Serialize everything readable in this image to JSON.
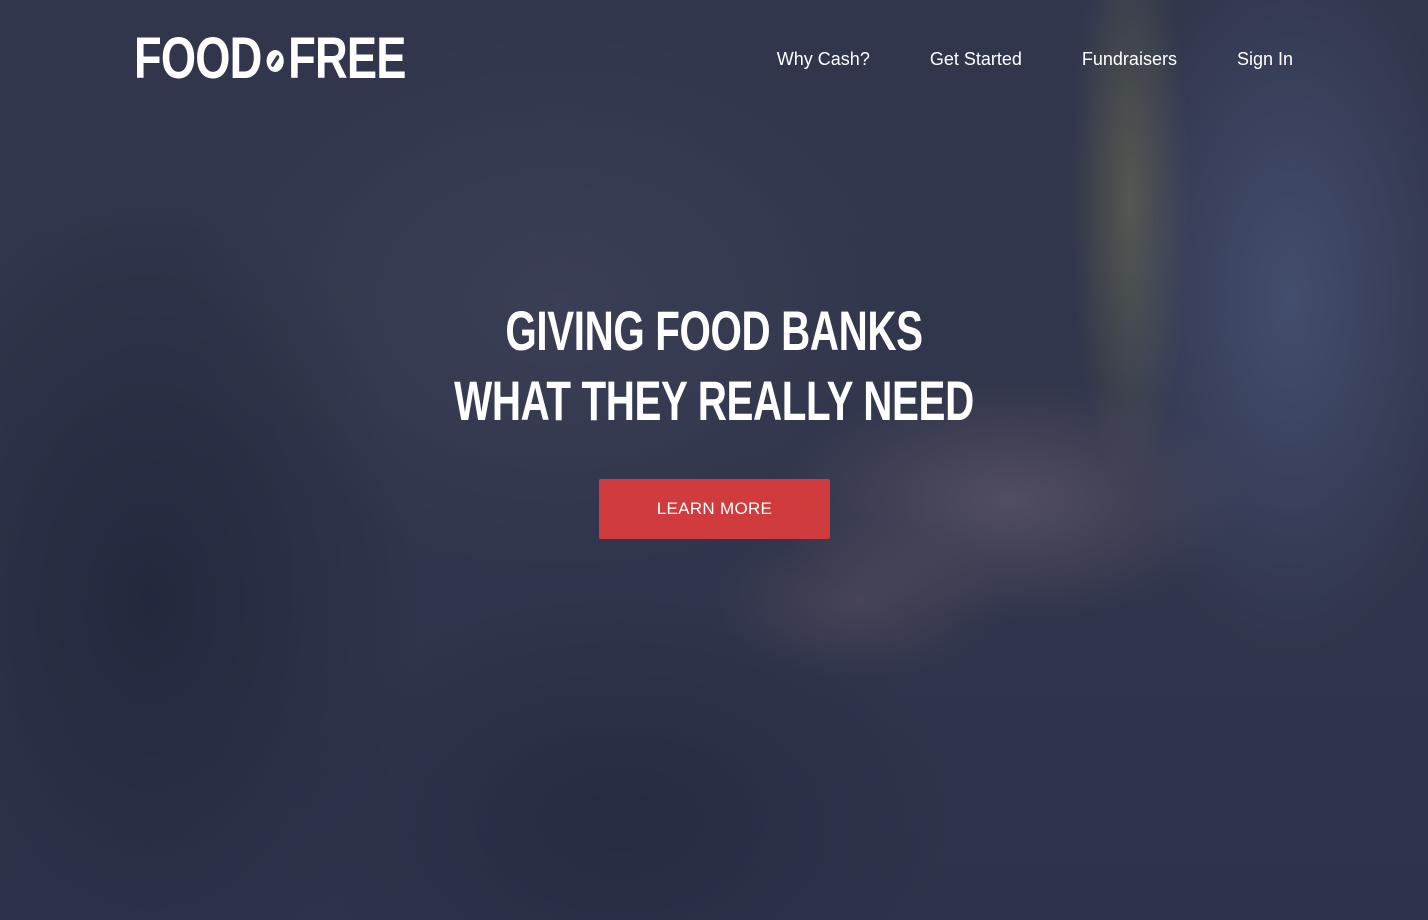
{
  "brand": {
    "logo_left": "FOOD",
    "logo_right": "FREE"
  },
  "nav": {
    "items": [
      {
        "label": "Why Cash?"
      },
      {
        "label": "Get Started"
      },
      {
        "label": "Fundraisers"
      },
      {
        "label": "Sign In"
      }
    ]
  },
  "hero": {
    "headline_line_1": "GIVING FOOD BANKS",
    "headline_line_2": "WHAT THEY REALLY NEED",
    "cta_label": "LEARN MORE"
  },
  "colors": {
    "cta_background": "#d03c3e",
    "text": "#ffffff",
    "overlay": "#262c46"
  }
}
